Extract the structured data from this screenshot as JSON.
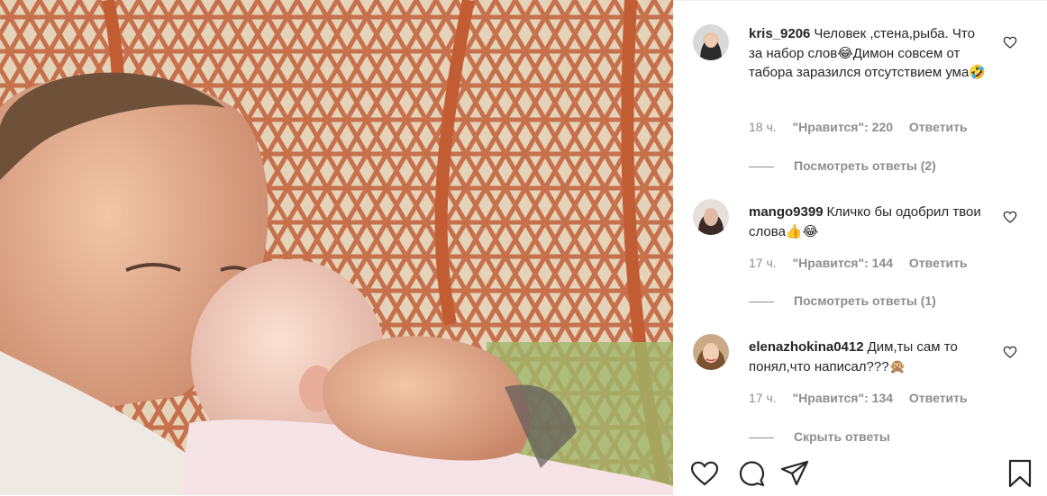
{
  "post": {
    "photo_description_icon": "photo-image"
  },
  "comments": [
    {
      "username": "kris_9206",
      "text": "Человек ,стена,рыба. Что за набор слов😂Димон совсем от табора заразился отсутствием ума🤣",
      "time": "18 ч.",
      "likes": "\"Нравится\": 220",
      "reply": "Ответить",
      "replies": "Посмотреть ответы (2)"
    },
    {
      "username": "mango9399",
      "text": "Кличко бы одобрил твои слова👍😂",
      "time": "17 ч.",
      "likes": "\"Нравится\": 144",
      "reply": "Ответить",
      "replies": "Посмотреть ответы (1)"
    },
    {
      "username": "elenazhokina0412",
      "text": "Дим,ты сам то понял,что написал???🙊",
      "time": "17 ч.",
      "likes": "\"Нравится\": 134",
      "reply": "Ответить",
      "replies": "Скрыть ответы"
    }
  ],
  "actions": {
    "like_icon": "heart-icon",
    "comment_icon": "comment-icon",
    "share_icon": "send-icon",
    "save_icon": "bookmark-icon"
  },
  "colors": {
    "text": "#262626",
    "secondary": "#8e8e8e",
    "border": "#efefef"
  }
}
